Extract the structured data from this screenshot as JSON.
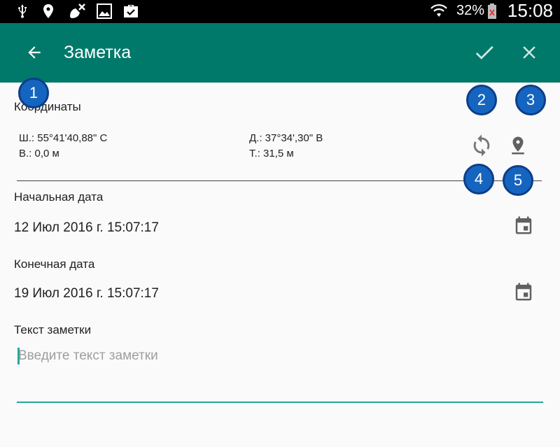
{
  "status_bar": {
    "battery": "32%",
    "time": "15:08",
    "icons": [
      "usb-icon",
      "location-icon",
      "satellite-off-icon",
      "image-icon",
      "briefcase-check-icon",
      "wifi-icon",
      "battery-icon"
    ]
  },
  "toolbar": {
    "title": "Заметка",
    "back_icon": "arrow-left-icon",
    "confirm_icon": "check-icon",
    "close_icon": "close-icon"
  },
  "coordinates": {
    "label": "Координаты",
    "lat": "Ш.: 55°41'40,88\" С",
    "lon": "Д.: 37°34',30\" В",
    "alt": "В.: 0,0 м",
    "acc": "Т.: 31,5 м"
  },
  "start_date": {
    "label": "Начальная дата",
    "value": "12 Июл 2016 г. 15:07:17"
  },
  "end_date": {
    "label": "Конечная дата",
    "value": "19 Июл 2016 г. 15:07:17"
  },
  "note": {
    "label": "Текст заметки",
    "placeholder": "Введите текст заметки",
    "value": ""
  },
  "badges": [
    "1",
    "2",
    "3",
    "4",
    "5"
  ],
  "colors": {
    "toolbar": "#00796b",
    "accent": "#26a69a",
    "badge": "#1565c0"
  }
}
